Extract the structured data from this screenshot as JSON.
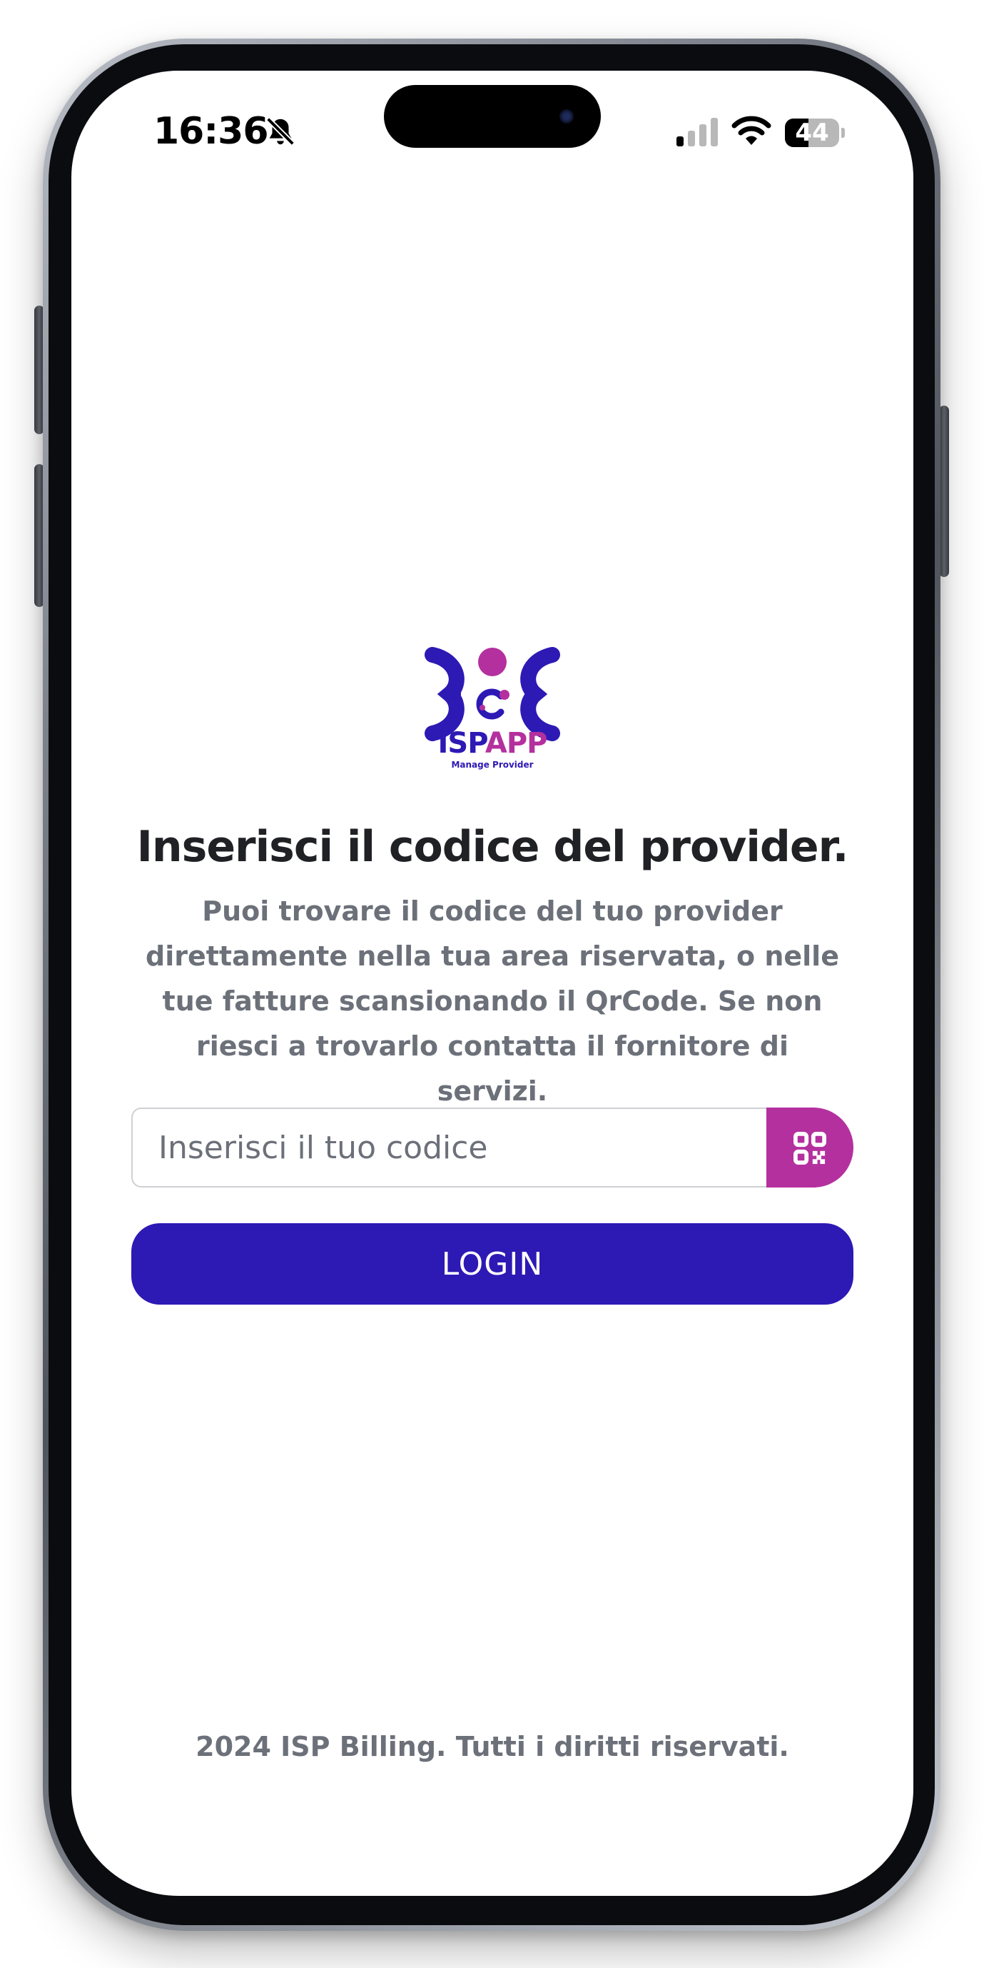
{
  "status_bar": {
    "time": "16:36",
    "battery_level": "44",
    "battery_fraction": 0.44,
    "signal_bars_active": 1,
    "signal_bars_total": 4,
    "icons": [
      "bell-slash-icon",
      "signal-icon",
      "wifi-icon",
      "battery-icon"
    ]
  },
  "logo": {
    "wordmark_primary": "ISP",
    "wordmark_accent": "APP",
    "tagline": "Manage Provider",
    "colors": {
      "primary": "#2d19b4",
      "accent": "#b4309e"
    }
  },
  "main": {
    "title": "Inserisci il codice del provider.",
    "description": "Puoi trovare il codice del tuo provider direttamente nella tua area riservata, o nelle tue fatture scansionando il QrCode. Se non riesci a trovarlo contatta il fornitore di servizi.",
    "code_input": {
      "value": "",
      "placeholder": "Inserisci il tuo codice"
    },
    "qr_button_icon": "qr-code-icon",
    "login_label": "LOGIN"
  },
  "footer": {
    "text": "2024 ISP Billing. Tutti i diritti riservati."
  },
  "colors": {
    "brand_primary": "#2d19b4",
    "brand_accent": "#b4309e",
    "text_dark": "#1f2125",
    "text_muted": "#6c7079"
  }
}
